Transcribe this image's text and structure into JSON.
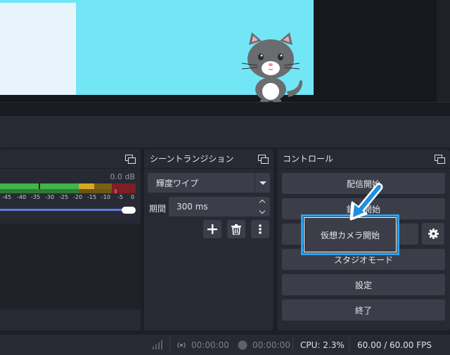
{
  "preview": {
    "scene_colors": {
      "background": "#73e6f6",
      "panel": "#e8f4fb"
    }
  },
  "mixer": {
    "db_label": "0.0 dB",
    "ticks": [
      "-45",
      "-40",
      "-35",
      "-30",
      "-25",
      "-20",
      "-15",
      "-10",
      "-5",
      "0"
    ],
    "volume_level": 0.95
  },
  "transition": {
    "title": "シーントランジション",
    "selected": "輝度ワイプ",
    "duration_label": "期間",
    "duration_value": "300 ms",
    "buttons": {
      "add": "plus-icon",
      "remove": "trash-icon",
      "more": "more-icon"
    }
  },
  "controls": {
    "title": "コントロール",
    "start_streaming": "配信開始",
    "start_recording": "録画開始",
    "start_virtualcam": "仮想カメラ開始",
    "studio_mode": "スタジオモード",
    "settings": "設定",
    "exit": "終了",
    "highlight_color": "#2ba4f0"
  },
  "status": {
    "stream_time": "00:00:00",
    "record_time": "00:00:00",
    "cpu": "CPU: 2.3%",
    "fps": "60.00 / 60.00 FPS"
  }
}
